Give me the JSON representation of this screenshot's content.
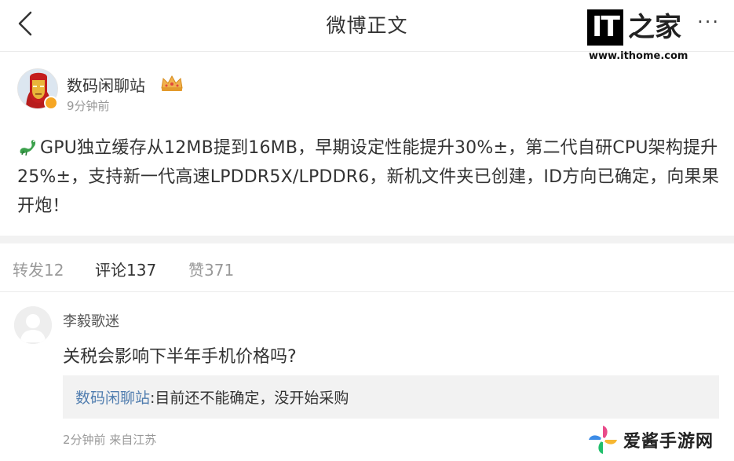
{
  "header": {
    "title": "微博正文",
    "more_label": "···"
  },
  "watermark": {
    "logo_it": "IT",
    "logo_zj": "之家",
    "url": "www.ithome.com",
    "bottom_text": "爱酱手游网"
  },
  "post": {
    "author": "数码闲聊站",
    "time": "9分钟前",
    "text": "GPU独立缓存从12MB提到16MB，早期设定性能提升30%±，第二代自研CPU架构提升25%±，支持新一代高速LPDDR5X/LPDDR6，新机文件夹已创建，ID方向已确定，向果果开炮！"
  },
  "tabs": [
    {
      "label": "转发12",
      "active": false
    },
    {
      "label": "评论137",
      "active": true
    },
    {
      "label": "赞371",
      "active": false
    }
  ],
  "comment": {
    "author": "李毅歌迷",
    "text": "关税会影响下半年手机价格吗?",
    "reply_author": "数码闲聊站",
    "reply_text": ":目前还不能确定，没开始采购",
    "meta": "2分钟前 来自江苏"
  },
  "colors": {
    "link": "#507daf",
    "badge": "#f6a623",
    "muted": "#999999"
  }
}
